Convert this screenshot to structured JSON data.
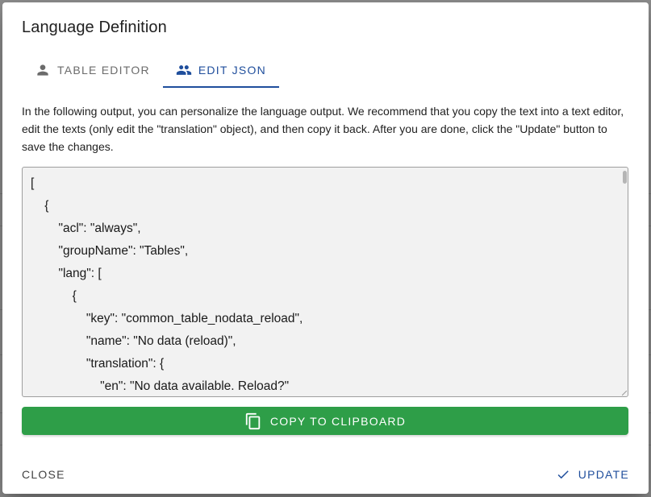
{
  "dialog": {
    "title": "Language Definition"
  },
  "tabs": [
    {
      "label": "TABLE EDITOR",
      "icon": "person-icon",
      "active": false
    },
    {
      "label": "EDIT JSON",
      "icon": "people-icon",
      "active": true
    }
  ],
  "description": "In the following output, you can personalize the language output. We recommend that you copy the text into a text editor, edit the texts (only edit the \"translation\" object), and then copy it back. After you are done, click the \"Update\" button to save the changes.",
  "json_editor": {
    "content": "[\n    {\n        \"acl\": \"always\",\n        \"groupName\": \"Tables\",\n        \"lang\": [\n            {\n                \"key\": \"common_table_nodata_reload\",\n                \"name\": \"No data (reload)\",\n                \"translation\": {\n                    \"en\": \"No data available. Reload?\"\n                }\n            }\n        ]\n    }\n]"
  },
  "actions": {
    "copy_label": "COPY TO CLIPBOARD",
    "copy_icon": "copy-icon",
    "close_label": "CLOSE",
    "update_label": "UPDATE",
    "update_icon": "check-icon"
  },
  "colors": {
    "accent": "#1f4e9c",
    "copy_button": "#2e9e48",
    "editor_background": "#f2f2f2"
  }
}
